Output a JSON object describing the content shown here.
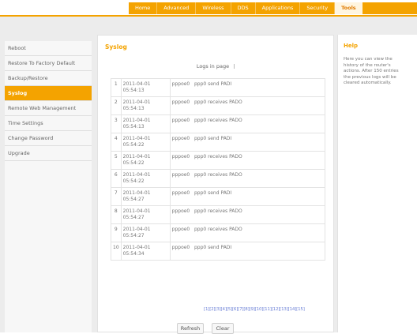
{
  "nav": {
    "tabs": [
      "Home",
      "Advanced",
      "Wireless",
      "DDS",
      "Applications",
      "Security",
      "Tools"
    ],
    "active_index": 6
  },
  "sidebar": {
    "items": [
      {
        "label": "Reboot",
        "active": false
      },
      {
        "label": "Restore To Factory Default",
        "active": false
      },
      {
        "label": "Backup/Restore",
        "active": false
      },
      {
        "label": "Syslog",
        "active": true
      },
      {
        "label": "Remote Web Management",
        "active": false
      },
      {
        "label": "Time Settings",
        "active": false
      },
      {
        "label": "Change Password",
        "active": false
      },
      {
        "label": "Upgrade",
        "active": false
      }
    ]
  },
  "main": {
    "title": "Syslog",
    "logs_heading": "Logs in page",
    "logs": [
      {
        "index": "1",
        "date": "2011-04-01",
        "time": "05:54:13",
        "message": "pppoe0   ppp0 send PADI"
      },
      {
        "index": "2",
        "date": "2011-04-01",
        "time": "05:54:13",
        "message": "pppoe0   ppp0 receives PADO"
      },
      {
        "index": "3",
        "date": "2011-04-01",
        "time": "05:54:13",
        "message": "pppoe0   ppp0 receives PADO"
      },
      {
        "index": "4",
        "date": "2011-04-01",
        "time": "05:54:22",
        "message": "pppoe0   ppp0 send PADI"
      },
      {
        "index": "5",
        "date": "2011-04-01",
        "time": "05:54:22",
        "message": "pppoe0   ppp0 receives PADO"
      },
      {
        "index": "6",
        "date": "2011-04-01",
        "time": "05:54:22",
        "message": "pppoe0   ppp0 receives PADO"
      },
      {
        "index": "7",
        "date": "2011-04-01",
        "time": "05:54:27",
        "message": "pppoe0   ppp0 send PADI"
      },
      {
        "index": "8",
        "date": "2011-04-01",
        "time": "05:54:27",
        "message": "pppoe0   ppp0 receives PADO"
      },
      {
        "index": "9",
        "date": "2011-04-01",
        "time": "05:54:27",
        "message": "pppoe0   ppp0 receives PADO"
      },
      {
        "index": "10",
        "date": "2011-04-01",
        "time": "05:54:34",
        "message": "pppoe0   ppp0 send PADI"
      }
    ],
    "pagination": "[1][2][3][4][5][6][7][8][9][10][11][12][13][14][15]",
    "refresh_label": "Refresh",
    "clear_label": "Clear"
  },
  "help": {
    "title": "Help",
    "text": "Here you can view the\nhistory of the router's\nactions. After 150 entries\nthe previous logs will be\ncleared automatically."
  },
  "colors": {
    "accent": "#f4a300",
    "link": "#6a7fd6"
  }
}
